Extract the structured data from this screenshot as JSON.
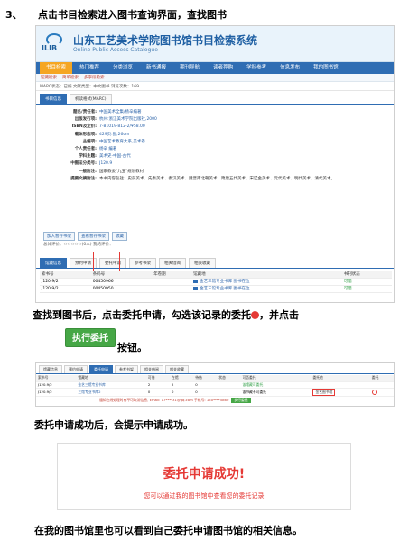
{
  "step": {
    "number": "3、",
    "heading": "点击书目检索进入图书查询界面，查找图书"
  },
  "catalogue": {
    "title": "山东工艺美术学院图书馆书目检索系统",
    "subtitle": "Online Public Access Catalogue",
    "logo_text": "ILIB",
    "nav": [
      "书目检索",
      "热门推荐",
      "分类浏览",
      "新书通报",
      "期刊导航",
      "读者荐购",
      "学科参考",
      "信息发布",
      "我的图书馆"
    ],
    "subnav": [
      "馆藏检索",
      "简单检索",
      "多字段检索"
    ],
    "marc_bar": "MARC状态：已编 文献类型：中文图书 浏览次数：169",
    "tabs": [
      "书目信息",
      "机读格式(MARC)"
    ],
    "record": [
      {
        "key": "题名/责任者:",
        "value": "中国美术全集/杨辛编著"
      },
      {
        "key": "出版发行项:",
        "value": "杭州:浙江美术学院出版社,2000"
      },
      {
        "key": "ISBN及定价:",
        "value": "7-81019-812-2/¥58.00"
      },
      {
        "key": "载体形态项:",
        "value": "429页:图;26cm"
      },
      {
        "key": "丛编项:",
        "value": "中国艺术教育大系,美术卷"
      },
      {
        "key": "个人责任者:",
        "value": "杨辛 编著"
      },
      {
        "key": "学科主题:",
        "value": "美术史-中国-古代"
      },
      {
        "key": "中图法分类号:",
        "value": "J120.9"
      },
      {
        "key": "一般附注:",
        "value": "国家教委\"九五\"规划教材"
      },
      {
        "key": "提要文摘附注:",
        "value": "本书内容包括：史前美术、先秦美术、秦汉美术、魏晋南北朝美术、隋唐五代美术、宋辽金美术、元代美术、明代美术、清代美术。"
      }
    ],
    "action_buttons": [
      "加入暂存书架",
      "查看暂存书架",
      "收藏"
    ],
    "rating": "总体评价：☆☆☆☆☆(0人)  我的评价：",
    "lower_tabs": [
      "馆藏信息",
      "预约申请",
      "委托申请",
      "参考书架",
      "相关借阅",
      "相关收藏"
    ],
    "table_headers": [
      "索书号",
      "条码号",
      "年卷期",
      "馆藏地",
      "书刊状态"
    ],
    "table_rows": [
      [
        "J120.9/2",
        "00450966",
        "",
        "金艺三馆专业书库    图书在位",
        "可借"
      ],
      [
        "J120.9/2",
        "00450950",
        "",
        "金艺三馆专业书库    图书在位",
        "可借"
      ]
    ]
  },
  "instruction1": {
    "text": "查找到图书后，点击委托申请，勾选该记录的委托",
    "tail": "，并点击",
    "button": "执行委托",
    "after": "按钮。"
  },
  "request": {
    "tabs": [
      "馆藏信息",
      "预约申请",
      "委托申请",
      "参考书架",
      "相关借阅",
      "相关收藏"
    ],
    "headers": [
      "索书号",
      "馆藏地",
      "可借",
      "在馆",
      "待借",
      "状态",
      "可否委托",
      "",
      "委托地",
      "委托"
    ],
    "rows": [
      [
        "J120.9/2",
        "金艺三馆专业书库",
        "2",
        "2",
        "0",
        "",
        "该馆藏可委托",
        "",
        "",
        ""
      ],
      [
        "J120.9/2",
        "三馆专业书库2",
        "0",
        "0",
        "0",
        "",
        "该书藏不可委托",
        "",
        "金艺图书馆",
        ""
      ]
    ],
    "note": "通知在线处理时有不可取消信息, Email: 17****31@qq.com 手机号: 150****5860",
    "exec": "执行委托"
  },
  "instruction2": "委托申请成功后，会提示申请成功。",
  "success": {
    "title": "委托申请成功!",
    "subtitle": "您可以通过我的图书馆中查看您的委托记录"
  },
  "instruction3": "在我的图书馆里也可以看到自己委托申请图书馆的相关信息。"
}
